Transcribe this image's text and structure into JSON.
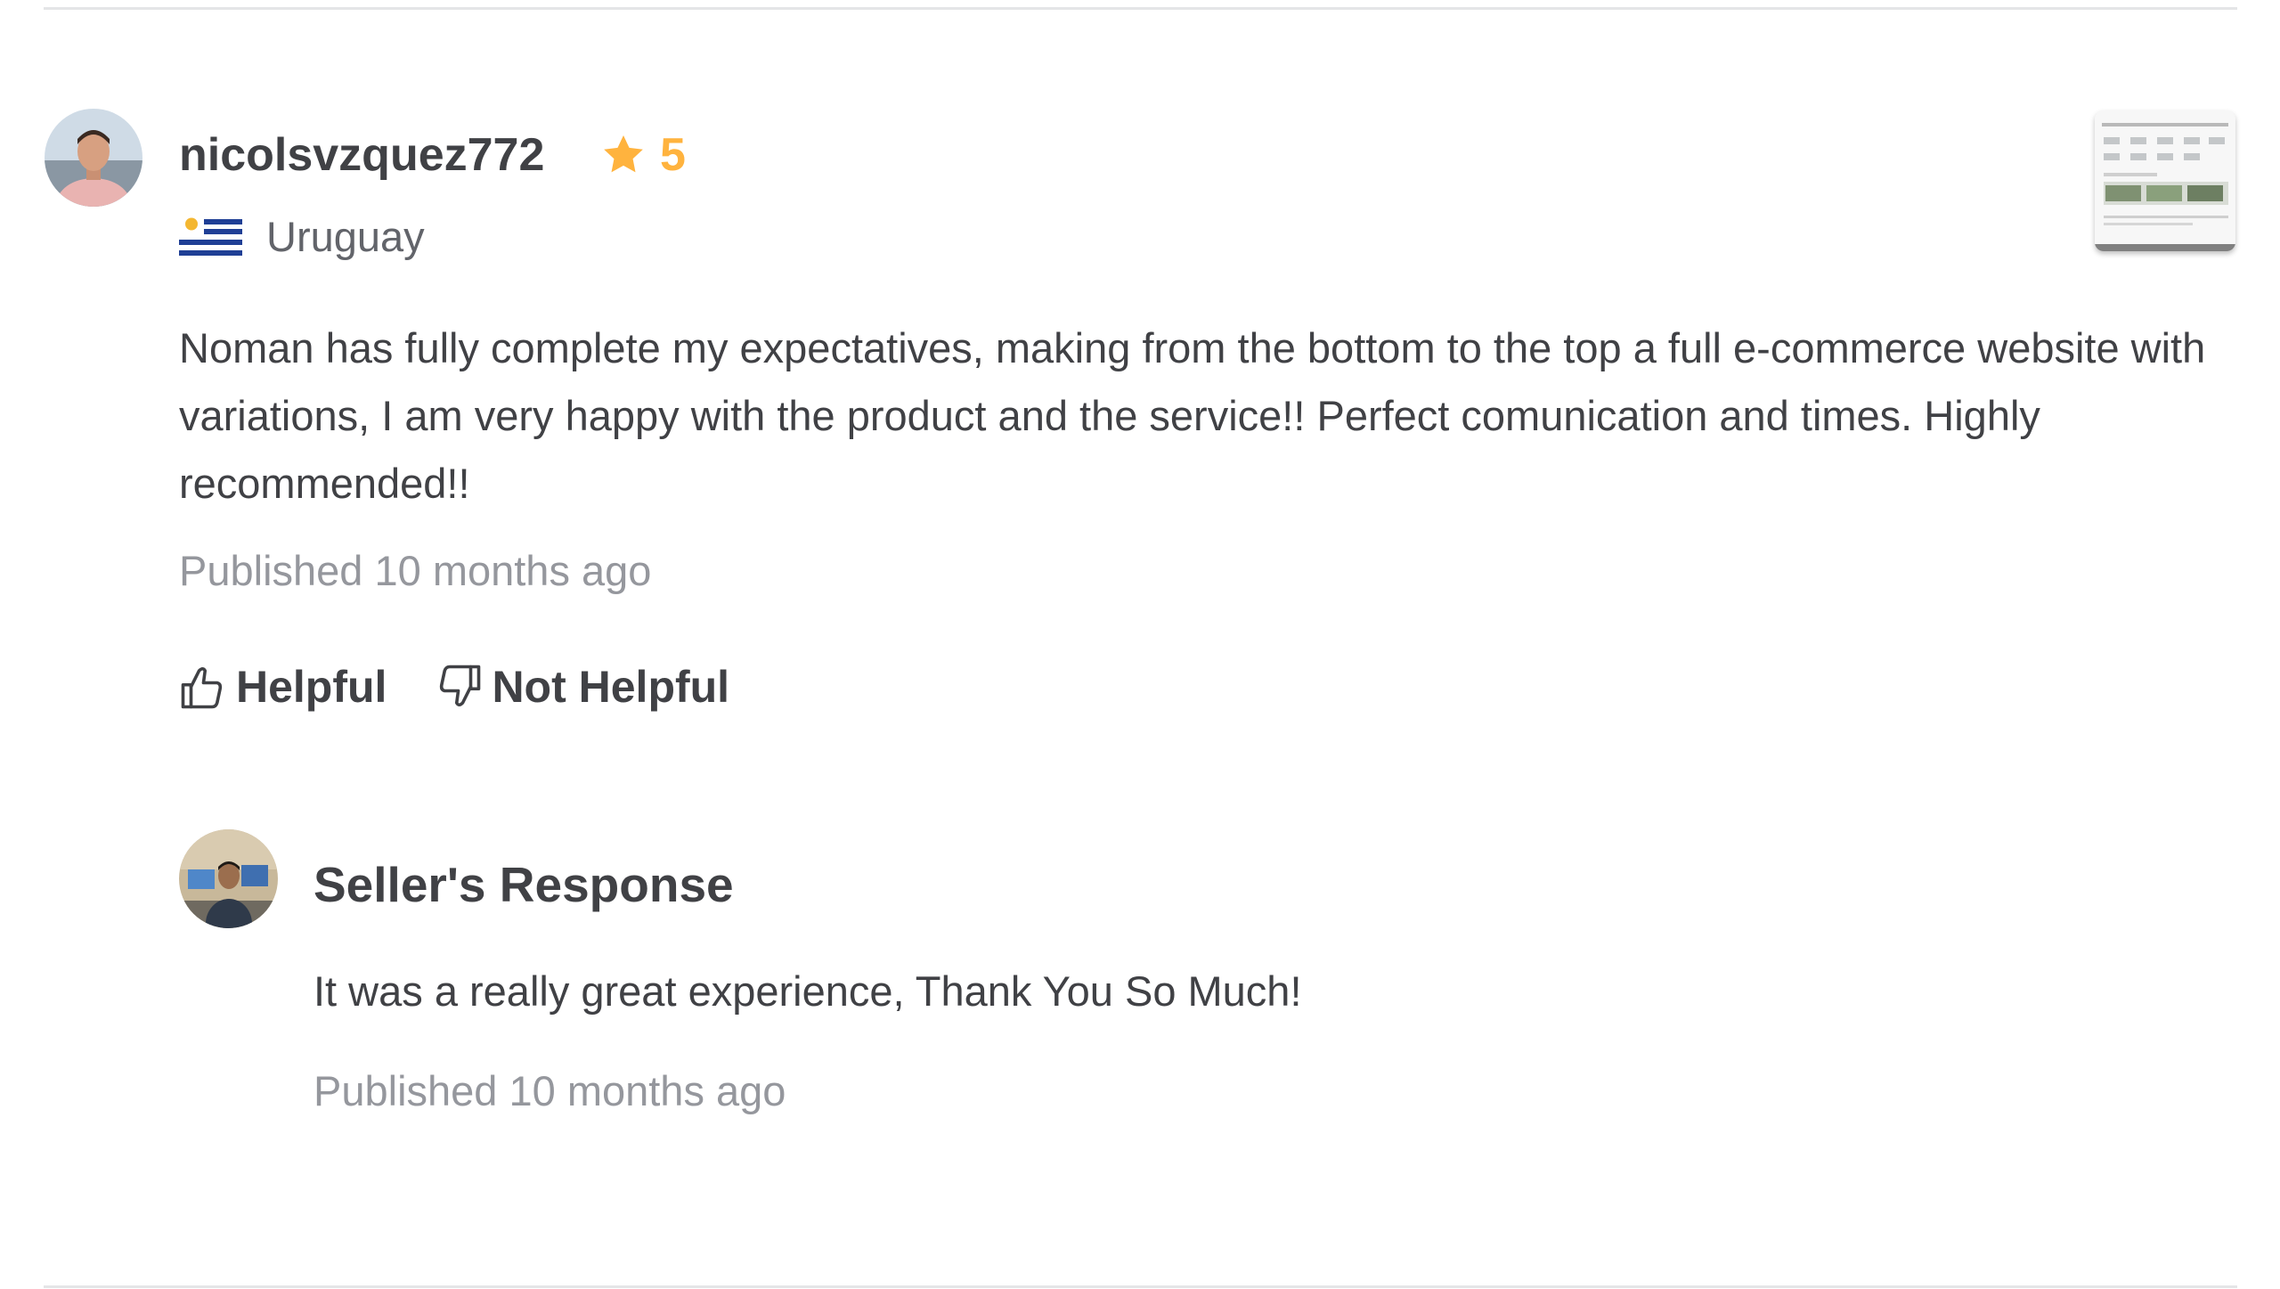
{
  "review": {
    "username": "nicolsvzquez772",
    "rating": "5",
    "country": "Uruguay",
    "text": "Noman has fully complete my expectatives, making from the bottom to the top a full e-commerce website with variations, I am very happy with the product and the service!! Perfect comunication and times. Highly recommended!!",
    "published": "Published 10 months ago",
    "helpful_label": "Helpful",
    "not_helpful_label": "Not Helpful"
  },
  "seller_response": {
    "title": "Seller's Response",
    "text": "It was a really great experience, Thank You So Much!",
    "published": "Published 10 months ago"
  },
  "icons": {
    "star": "star-icon",
    "flag": "uruguay-flag-icon",
    "helpful": "thumbs-up-icon",
    "not_helpful": "thumbs-down-icon"
  },
  "colors": {
    "star": "#ffb33e",
    "text": "#404145",
    "muted": "#95979d",
    "divider": "#e4e5e7"
  }
}
